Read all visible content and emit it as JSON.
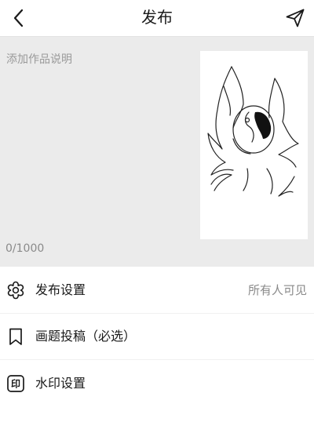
{
  "header": {
    "title": "发布"
  },
  "editor": {
    "description_value": "",
    "description_placeholder": "添加作品说明",
    "char_count": "0/1000"
  },
  "settings": {
    "publish": {
      "label": "发布设置",
      "value": "所有人可见",
      "icon": "flower-settings-icon"
    },
    "submit": {
      "label": "画题投稿（必选）",
      "icon": "bookmark-icon"
    },
    "watermark": {
      "label": "水印设置",
      "icon": "watermark-stamp-icon",
      "icon_text": "印"
    }
  }
}
